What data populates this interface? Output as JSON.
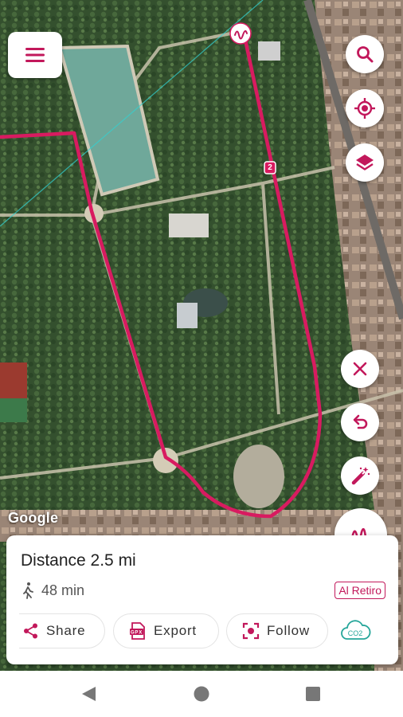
{
  "map": {
    "attribution": "Google",
    "waypoint_label": "2"
  },
  "controls": {
    "menu_icon": "hamburger-icon",
    "search_icon": "search-icon",
    "location_icon": "crosshair-icon",
    "layers_icon": "layers-icon",
    "clear_icon": "close-icon",
    "undo_icon": "undo-icon",
    "magic_icon": "magic-wand-icon",
    "draw_icon": "squiggle-icon"
  },
  "route": {
    "distance_label": "Distance 2.5 mi",
    "duration_label": "48 min",
    "place_tag": "Al Retiro",
    "actions": [
      {
        "label": "Share",
        "icon": "share-icon"
      },
      {
        "label": "Export",
        "icon": "gpx-file-icon"
      },
      {
        "label": "Follow",
        "icon": "follow-target-icon"
      }
    ],
    "co2_label": "CO2"
  },
  "colors": {
    "accent": "#C2185B",
    "route_line": "#D81B60",
    "co2": "#26A69A"
  },
  "navbar": {
    "back_icon": "triangle-back-icon",
    "home_icon": "circle-home-icon",
    "recents_icon": "square-recents-icon"
  }
}
